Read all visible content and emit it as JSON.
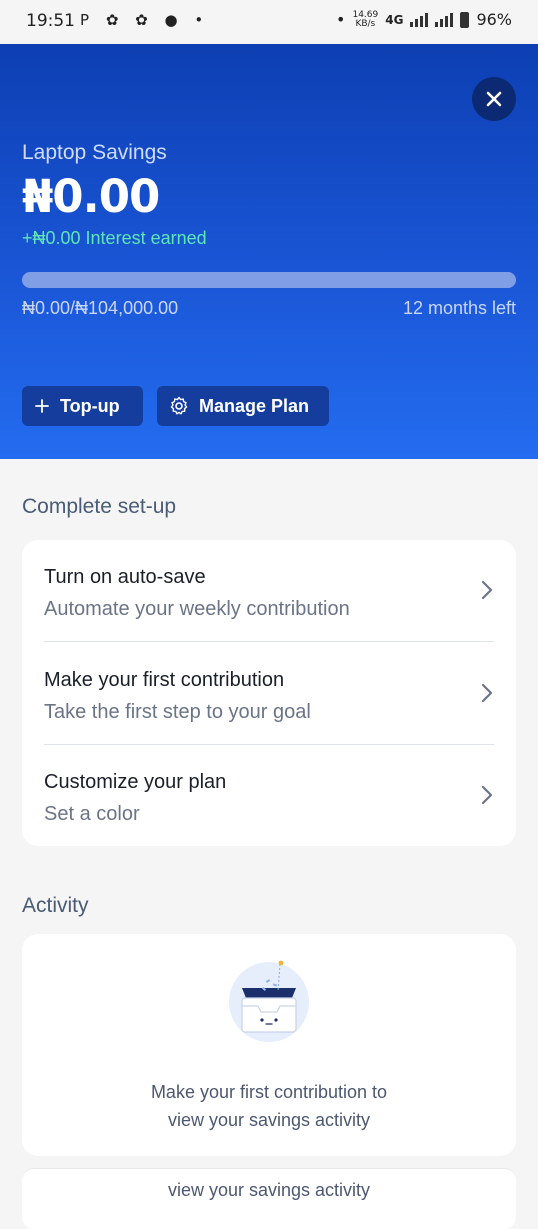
{
  "status_bar": {
    "time": "19:51",
    "left_icons": "P ✿ ✿ ● •",
    "dot": "•",
    "net_speed_value": "14.69",
    "net_speed_unit": "KB/s",
    "network": "4G",
    "battery": "96%"
  },
  "hero": {
    "plan_name": "Laptop Savings",
    "balance": "₦0.00",
    "interest": "+₦0.00 Interest earned",
    "progress_text": "₦0.00/₦104,000.00",
    "progress_fraction": 0,
    "months_left": "12 months left",
    "topup_label": "Top-up",
    "manage_label": "Manage Plan",
    "close_icon": "close-icon",
    "colors": {
      "gradient_top": "#0d3fb3",
      "gradient_bottom": "#246cf0",
      "interest_green": "#5ee6b8"
    }
  },
  "setup": {
    "title": "Complete set-up",
    "items": [
      {
        "title": "Turn on auto-save",
        "subtitle": "Automate your weekly contribution"
      },
      {
        "title": "Make your first contribution",
        "subtitle": "Take the first step to your goal"
      },
      {
        "title": "Customize your plan",
        "subtitle": "Set a color"
      }
    ]
  },
  "activity": {
    "title": "Activity",
    "empty_line1": "Make your first contribution to",
    "empty_line2": "view your savings activity",
    "peek_text": "view your savings activity"
  }
}
